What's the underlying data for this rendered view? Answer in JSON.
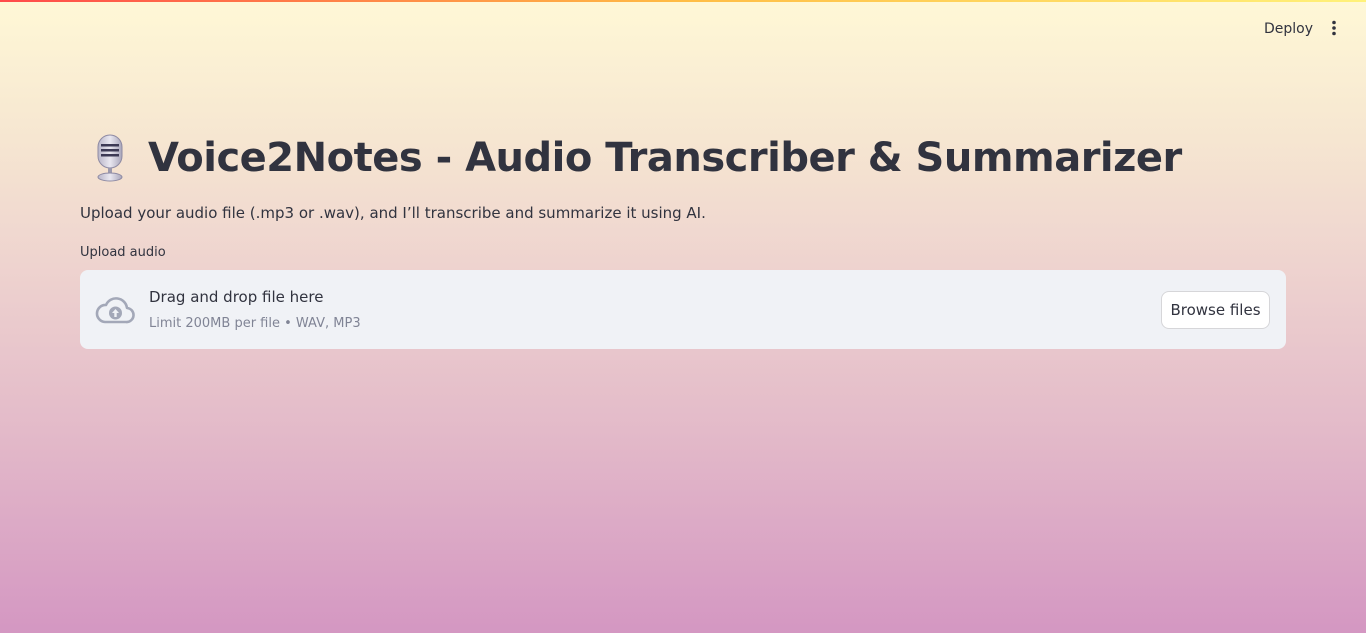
{
  "header": {
    "deploy_label": "Deploy",
    "menu_icon": "vertical-ellipsis-icon"
  },
  "main": {
    "title_icon": "studio-microphone-icon",
    "title": "Voice2Notes - Audio Transcriber & Summarizer",
    "subtitle": "Upload your audio file (.mp3 or .wav), and I’ll transcribe and summarize it using AI."
  },
  "uploader": {
    "label": "Upload audio",
    "icon": "cloud-upload-icon",
    "drop_title": "Drag and drop file here",
    "limit_text": "Limit 200MB per file • WAV, MP3",
    "browse_label": "Browse files"
  },
  "colors": {
    "gradient_top": "#fff8d6",
    "gradient_bottom": "#d497c2",
    "text": "#31333f",
    "dropzone_bg": "#f0f2f6",
    "muted_text": "#808495",
    "cloud_icon": "#a3a8b8"
  }
}
